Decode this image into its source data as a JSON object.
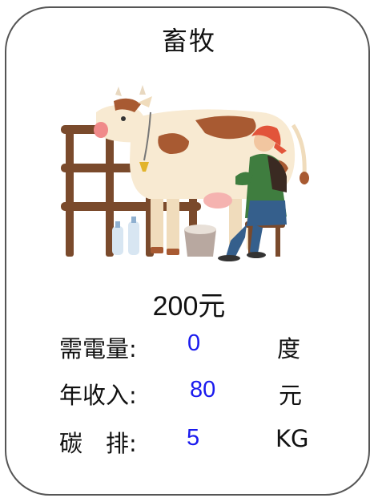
{
  "card": {
    "title": "畜牧",
    "illustration_icon": "dairy-cow-milking-icon",
    "price": "200元",
    "stats": [
      {
        "label": "需電量:",
        "value": "0",
        "unit": "度"
      },
      {
        "label": "年收入:",
        "value": "80",
        "unit": "元"
      },
      {
        "label": "碳　排:",
        "value": "5",
        "unit": "KG"
      }
    ]
  },
  "colors": {
    "value_text": "#1a1aee",
    "border": "#555555",
    "fence": "#7a4a2c",
    "cow_body": "#f8ead2",
    "cow_spots": "#a85a32",
    "farmer_shirt": "#3f7d3f"
  }
}
